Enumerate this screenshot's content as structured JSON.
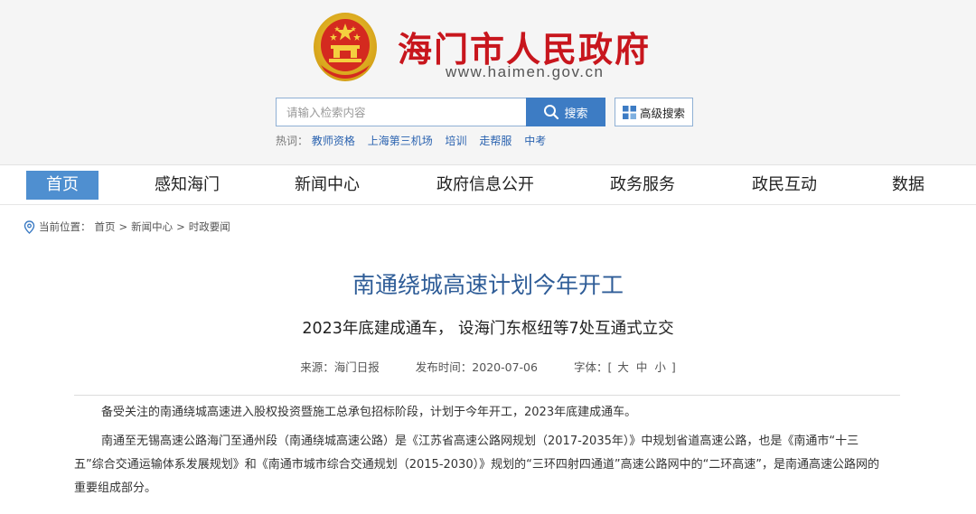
{
  "header": {
    "site_title": "海门市人民政府",
    "site_url": "www.haimen.gov.cn",
    "emblem_icon": "national-emblem-icon"
  },
  "search": {
    "placeholder": "请输入检索内容",
    "button_label": "搜索",
    "advanced_label": "高级搜索",
    "hotwords_label": "热词：",
    "hotwords": [
      "教师资格",
      "上海第三机场",
      "培训",
      "走帮服",
      "中考"
    ]
  },
  "nav": {
    "items": [
      "首页",
      "感知海门",
      "新闻中心",
      "政府信息公开",
      "政务服务",
      "政民互动",
      "数据"
    ],
    "active_index": 0
  },
  "breadcrumb": {
    "label": "当前位置：",
    "items": [
      "首页",
      "新闻中心",
      "时政要闻"
    ],
    "separator": ">"
  },
  "article": {
    "title": "南通绕城高速计划今年开工",
    "subtitle": "2023年底建成通车， 设海门东枢纽等7处互通式立交",
    "source": "来源：海门日报",
    "publish_time": "发布时间：2020-07-06",
    "font_label": "字体：[",
    "font_sizes": [
      "大",
      "中",
      "小"
    ],
    "font_close": "]",
    "paragraphs": [
      "备受关注的南通绕城高速进入股权投资暨施工总承包招标阶段，计划于今年开工，2023年底建成通车。",
      "南通至无锡高速公路海门至通州段（南通绕城高速公路）是《江苏省高速公路网规划（2017-2035年）》中规划省道高速公路，也是《南通市“十三五”综合交通运输体系发展规划》和《南通市城市综合交通规划（2015-2030）》规划的“三环四射四通道”高速公路网中的“二环高速”，是南通高速公路网的重要组成部分。"
    ]
  },
  "colors": {
    "brand_red": "#c8161d",
    "accent_blue": "#3d7cc4",
    "nav_active": "#4f8fd0",
    "title_blue": "#2e5c97"
  }
}
